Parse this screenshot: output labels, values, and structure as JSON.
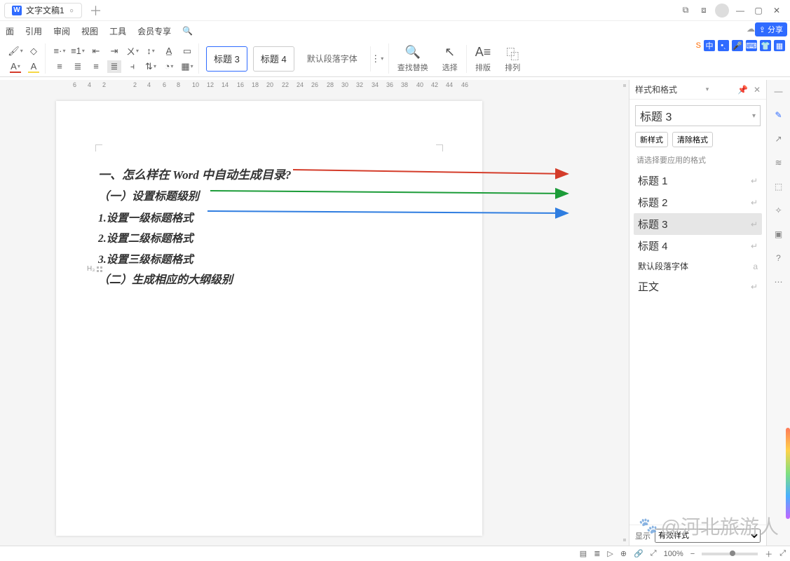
{
  "titlebar": {
    "tab": "文字文稿1"
  },
  "menu": {
    "items": [
      "面",
      "引用",
      "审阅",
      "视图",
      "工具",
      "会员专享"
    ],
    "share": "分享"
  },
  "ribbon": {
    "styles": {
      "h3": "标题 3",
      "h4": "标题 4",
      "default_font": "默认段落字体"
    },
    "cmds": {
      "findreplace": "查找替换",
      "select": "选择",
      "layout": "排版",
      "arrange": "排列"
    }
  },
  "ruler": [
    "6",
    "4",
    "2",
    "2",
    "4",
    "6",
    "8",
    "10",
    "12",
    "14",
    "16",
    "18",
    "20",
    "22",
    "24",
    "26",
    "28",
    "30",
    "32",
    "34",
    "36",
    "38",
    "40",
    "42",
    "44",
    "46"
  ],
  "document": {
    "marker": "H₃",
    "lines": [
      {
        "cls": "h1",
        "text": "一、怎么样在 Word 中自动生成目录?"
      },
      {
        "cls": "h2",
        "text": "（一）设置标题级别"
      },
      {
        "cls": "h3",
        "text": "1.设置一级标题格式"
      },
      {
        "cls": "h3",
        "text": "2.设置二级标题格式"
      },
      {
        "cls": "h3",
        "text": "3.设置三级标题格式"
      },
      {
        "cls": "h2",
        "text": "（二）生成相应的大纲级别"
      }
    ]
  },
  "panel": {
    "title": "样式和格式",
    "current": "标题 3",
    "new_style": "新样式",
    "clear_style": "清除格式",
    "hint": "请选择要应用的格式",
    "list": [
      {
        "label": "标题 1",
        "ret": "↵"
      },
      {
        "label": "标题 2",
        "ret": "↵"
      },
      {
        "label": "标题 3",
        "ret": "↵",
        "sel": true
      },
      {
        "label": "标题 4",
        "ret": "↵"
      },
      {
        "label": "默认段落字体",
        "ret": "a",
        "small": true
      },
      {
        "label": "正文",
        "ret": "↵"
      }
    ],
    "footer": {
      "show": "显示",
      "select": "有效样式"
    }
  },
  "status": {
    "zoom": "100%"
  },
  "watermark": "@河北旅游人",
  "ime": [
    "中"
  ]
}
